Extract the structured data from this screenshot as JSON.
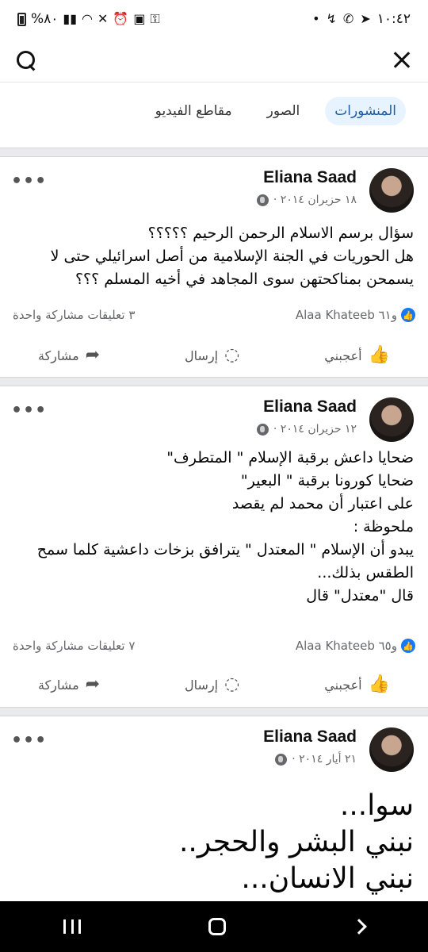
{
  "status_bar": {
    "time": "١٠:٤٢",
    "battery": "%٨٠"
  },
  "tabs": [
    {
      "label": "المنشورات",
      "active": true
    },
    {
      "label": "الصور",
      "active": false
    },
    {
      "label": "مقاطع الفيديو",
      "active": false
    }
  ],
  "posts": [
    {
      "author": "Eliana Saad",
      "date": "١٨ حزيران ٢٠١٤ ·",
      "lines": [
        "سؤال برسم الاسلام الرحمن الرحيم ؟؟؟؟؟",
        "هل الحوريات في الجنة الإسلامية من أصل اسرائيلي حتى لا",
        "يسمحن بمناكحتهن سوى المجاهد في أخيه المسلم ؟؟؟"
      ],
      "reactions": "Alaa Khateeb و٦١",
      "comments_shares": "٣ تعليقات  مشاركة واحدة"
    },
    {
      "author": "Eliana Saad",
      "date": "١٢ حزيران ٢٠١٤ ·",
      "lines": [
        "ضحايا داعش برقبة الإسلام \" المتطرف\"",
        "ضحايا كورونا برقبة \" البعير\"",
        "على اعتبار أن محمد لم يقصد",
        "ملحوظة :",
        "يبدو أن الإسلام \" المعتدل \" يترافق بزخات داعشية كلما سمح",
        "الطقس بذلك...",
        "قال \"معتدل\" قال"
      ],
      "reactions": "Alaa Khateeb و٦٥",
      "comments_shares": "٧ تعليقات  مشاركة واحدة"
    },
    {
      "author": "Eliana Saad",
      "date": "٢١ أيار ٢٠١٤ ·",
      "lines": [
        "سوا...",
        "نبني البشر والحجر..",
        "نبني الانسان..."
      ]
    }
  ],
  "actions": {
    "like": "أعجبني",
    "send": "إرسال",
    "share": "مشاركة"
  },
  "icons": {
    "status": [
      "battery-icon",
      "signal-icon",
      "wifi-icon",
      "mute-icon",
      "alarm-icon",
      "vpn-icon",
      "key-icon",
      "whatsapp-icon",
      "telegram-icon"
    ],
    "actions": [
      "thumb-up-icon",
      "messenger-icon",
      "share-arrow-icon"
    ]
  },
  "colors": {
    "active_tab_bg": "#e7f3ff",
    "active_tab_text": "#1e5c9c",
    "like_blue": "#1877f2",
    "secondary_text": "#65676b"
  }
}
